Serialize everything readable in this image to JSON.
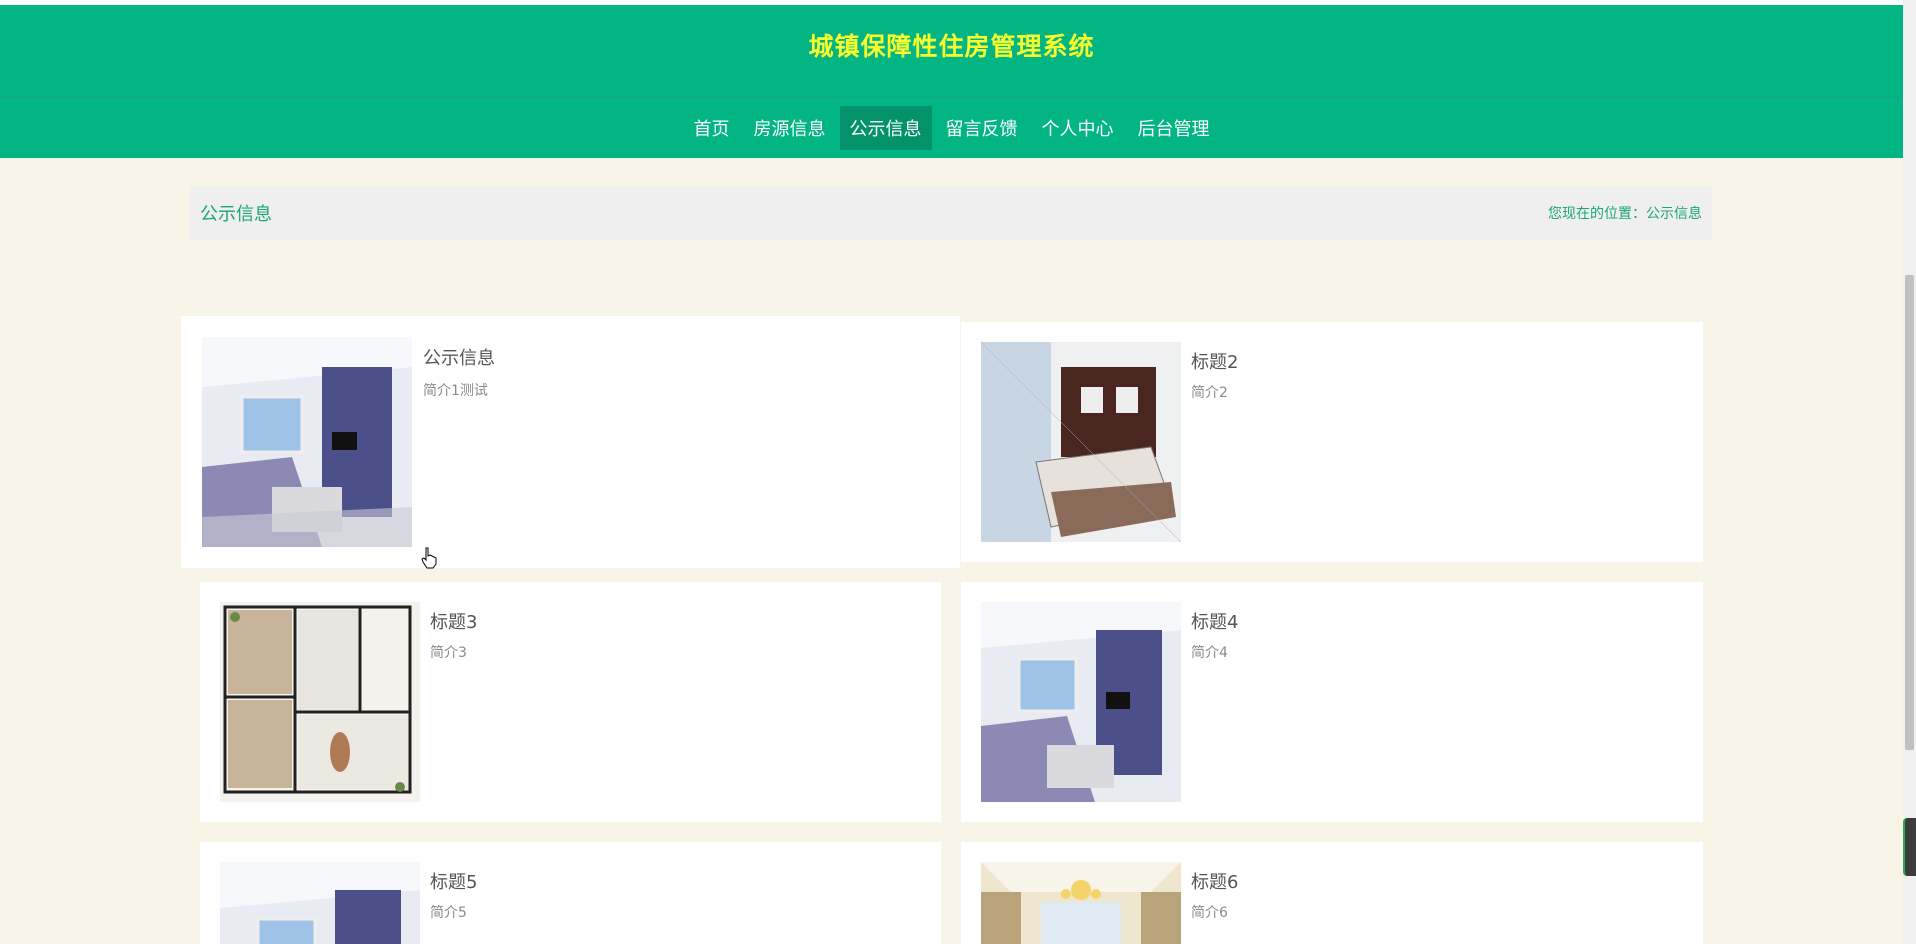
{
  "header": {
    "site_title": "城镇保障性住房管理系统"
  },
  "nav": {
    "items": [
      "首页",
      "房源信息",
      "公示信息",
      "留言反馈",
      "个人中心",
      "后台管理"
    ],
    "active": "公示信息"
  },
  "breadcrumb": {
    "title": "公示信息",
    "location": "您现在的位置：公示信息"
  },
  "cards": [
    {
      "title": "公示信息",
      "desc": "简介1测试",
      "image": "living-room"
    },
    {
      "title": "标题2",
      "desc": "简介2",
      "image": "bedroom-sketch"
    },
    {
      "title": "标题3",
      "desc": "简介3",
      "image": "floor-plan"
    },
    {
      "title": "标题4",
      "desc": "简介4",
      "image": "living-room"
    },
    {
      "title": "标题5",
      "desc": "简介5",
      "image": "living-room"
    },
    {
      "title": "标题6",
      "desc": "简介6",
      "image": "chandelier-room"
    }
  ],
  "colors": {
    "brand": "#02b582",
    "title_yellow": "#f7fe2e",
    "background": "#f9f4e8"
  }
}
